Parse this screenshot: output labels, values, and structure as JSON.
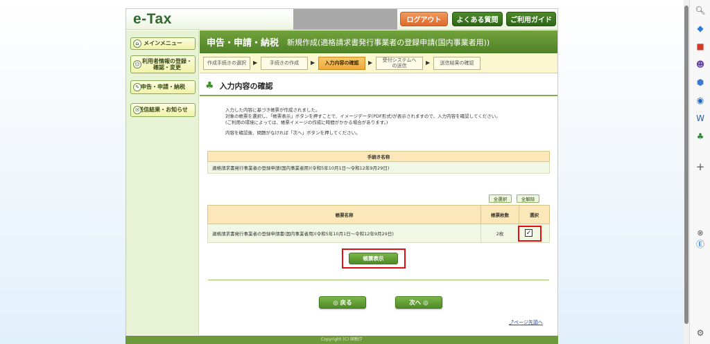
{
  "header": {
    "logo": "e-Tax",
    "logout_label": "ログアウト",
    "faq_label": "よくある質問",
    "guide_label": "ご利用ガイド"
  },
  "leftnav": {
    "items": [
      {
        "label": "メインメニュー",
        "icon": "home-icon"
      },
      {
        "label": "利用者情報の登録・確認・変更",
        "icon": "user-icon"
      },
      {
        "label": "申告・申請・納税",
        "icon": "pen-icon"
      },
      {
        "label": "送信結果・お知らせ",
        "icon": "mail-icon"
      }
    ]
  },
  "title": {
    "main": "申告・申請・納税",
    "sub": "新規作成(適格請求書発行事業者の登録申請(国内事業者用))"
  },
  "steps": [
    {
      "label": "作成手続きの選択",
      "active": false
    },
    {
      "label": "手続きの作成",
      "active": false
    },
    {
      "label": "入力内容の確認",
      "active": true
    },
    {
      "label": "受付システムへの送信",
      "active": false
    },
    {
      "label": "送信結果の確認",
      "active": false
    }
  ],
  "section_title": "入力内容の確認",
  "intro": {
    "line1": "入力した内容に基づき帳票が作成されました。",
    "line2": "対象の帳票を選択し、「帳票表示」ボタンを押すことで、イメージデータ(PDF形式)が表示されますので、入力内容を確認してください。",
    "line3": "(ご利用の環境によっては、帳票イメージの作成に時間がかかる場合があります。)",
    "line4": "内容を確認後、問題がなければ「次へ」ボタンを押してください。"
  },
  "procedure_table": {
    "header": "手続き名称",
    "value": "適格請求書発行事業者の登録申請(国内事業者用)(令和5年10月1日～令和12年9月29日)"
  },
  "select_all_label": "全選択",
  "deselect_all_label": "全解除",
  "form_table": {
    "headers": [
      "帳票名称",
      "帳票枚数",
      "選択"
    ],
    "rows": [
      {
        "name": "適格請求書発行事業者の登録申請書(国内事業者用)(令和5年10月1日～令和12年9月29日)",
        "count": "2枚",
        "selected": true
      }
    ]
  },
  "form_display_label": "帳票表示",
  "back_label": "◎ 戻る",
  "next_label": "次へ ◎",
  "page_top_label": "ページ先頭へ",
  "footer_text": "Copyright (C) 国税庁",
  "colors": {
    "accent_green": "#4f8228",
    "highlight_red": "#e01010",
    "active_step": "#efa93d"
  }
}
